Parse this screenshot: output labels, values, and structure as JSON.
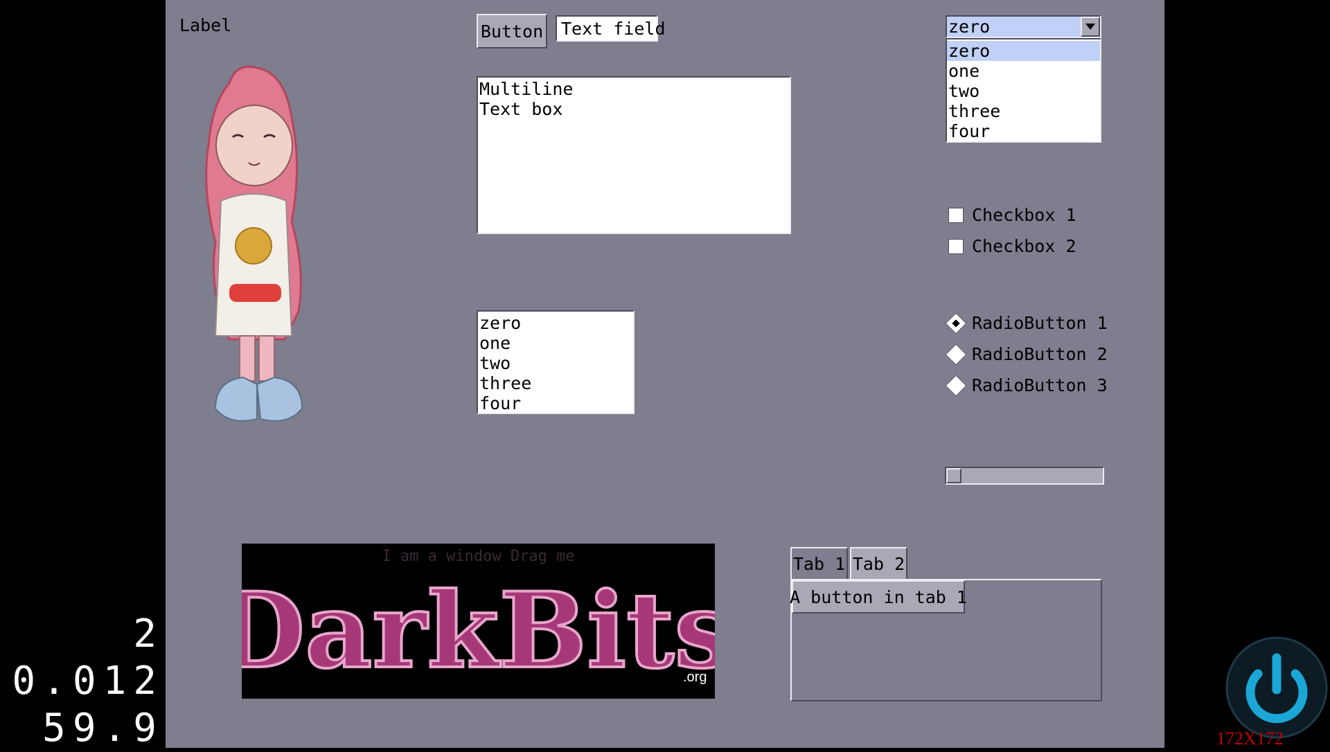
{
  "stats": {
    "line1": "2",
    "line2": "0.012",
    "line3": "59.9"
  },
  "label": "Label",
  "button": "Button",
  "text_field": "Text field",
  "multiline": [
    "Multiline",
    "Text box"
  ],
  "listbox": {
    "items": [
      "zero",
      "one",
      "two",
      "three",
      "four"
    ]
  },
  "combo": {
    "value": "zero",
    "options": [
      "zero",
      "one",
      "two",
      "three",
      "four"
    ],
    "highlighted": "zero"
  },
  "checkboxes": [
    {
      "label": "Checkbox 1",
      "checked": false
    },
    {
      "label": "Checkbox 2",
      "checked": false
    }
  ],
  "radios": [
    {
      "label": "RadioButton 1",
      "selected": true
    },
    {
      "label": "RadioButton 2",
      "selected": false
    },
    {
      "label": "RadioButton 3",
      "selected": false
    }
  ],
  "slider": {
    "value": 0
  },
  "window": {
    "title": "I am a window  Drag me",
    "logo_text": "DarkBits",
    "logo_suffix": ".org"
  },
  "tabs": {
    "items": [
      "Tab 1",
      "Tab 2"
    ],
    "active": "Tab 1",
    "tab1_button": "A button in tab 1"
  },
  "power_icon": "power-icon",
  "corner_text": "172X172",
  "colors": {
    "background": "#7e7e8e",
    "selection": "#c0d0f6",
    "logo_pink": "#c1448f",
    "power_blue": "#1aa7d6",
    "corner_text": "#c00000"
  }
}
